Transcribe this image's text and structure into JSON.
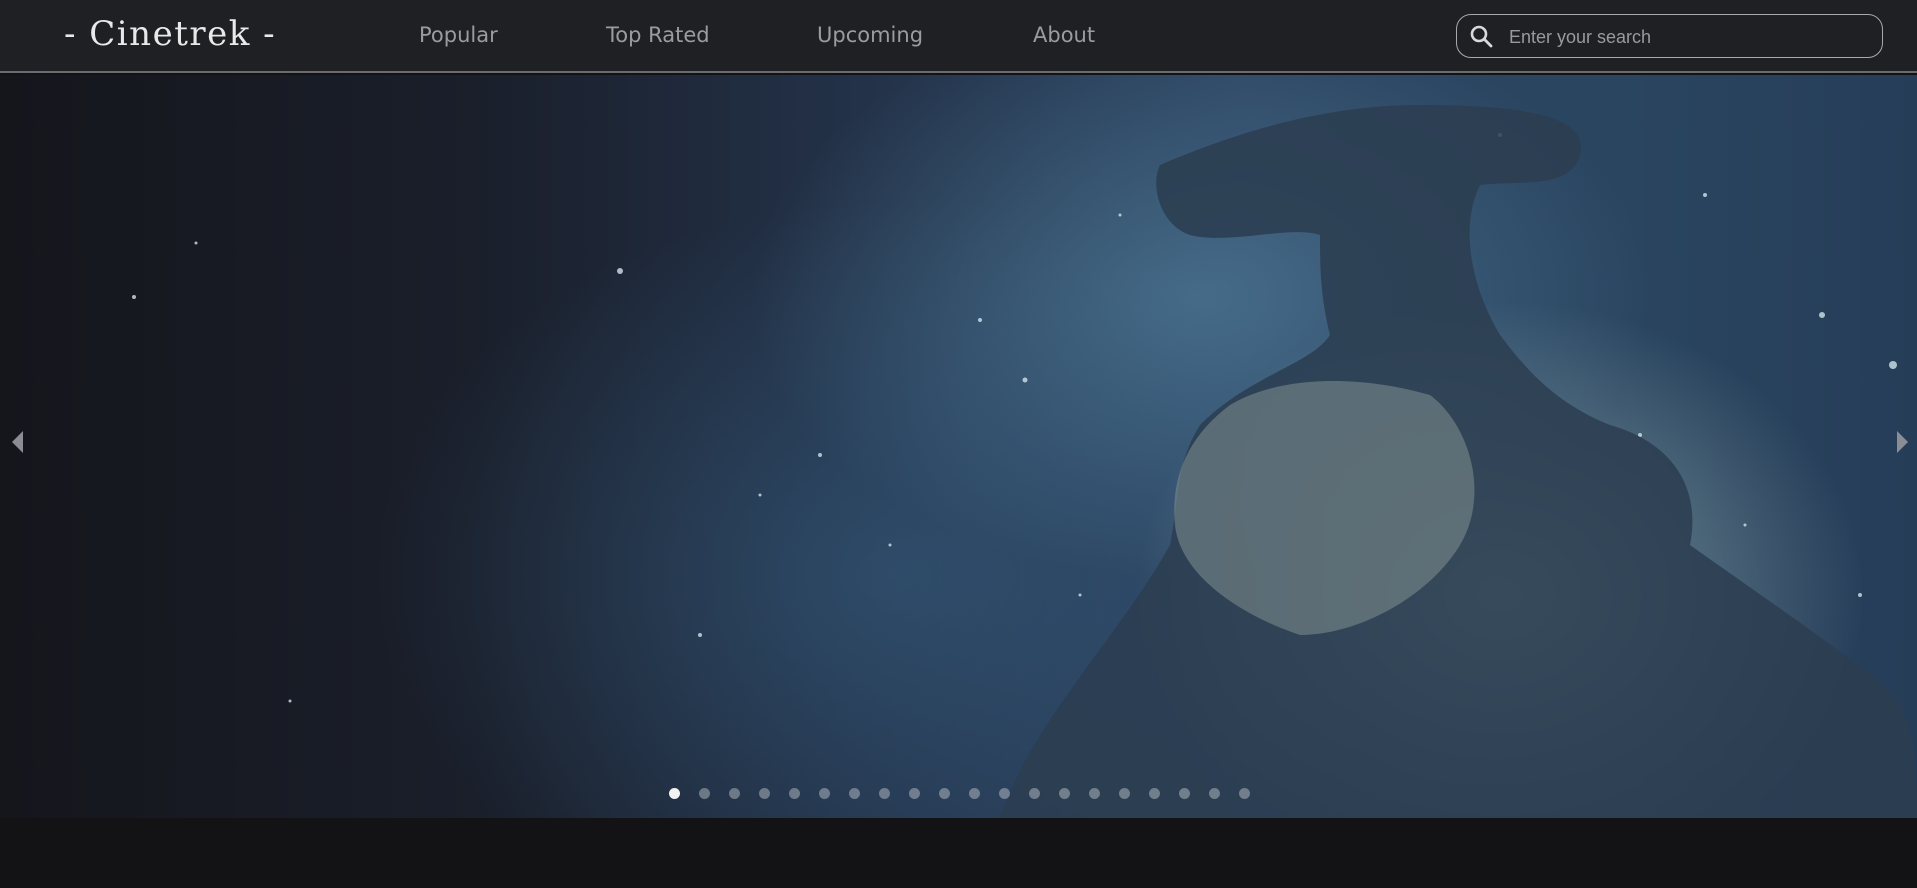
{
  "brand": {
    "logo_text": "- Cinetrek -"
  },
  "nav": {
    "items": [
      {
        "label": "Popular"
      },
      {
        "label": "Top Rated"
      },
      {
        "label": "Upcoming"
      },
      {
        "label": "About"
      }
    ]
  },
  "search": {
    "placeholder": "Enter your search",
    "icon": "search-icon"
  },
  "carousel": {
    "slide_count": 20,
    "active_index": 0,
    "prev_icon": "triangle-left-icon",
    "next_icon": "triangle-right-icon"
  },
  "colors": {
    "navbar_bg": "#1f2024",
    "page_bg": "#131315",
    "nav_text": "#9c9ca0",
    "logo_text": "#e9e9ea"
  }
}
